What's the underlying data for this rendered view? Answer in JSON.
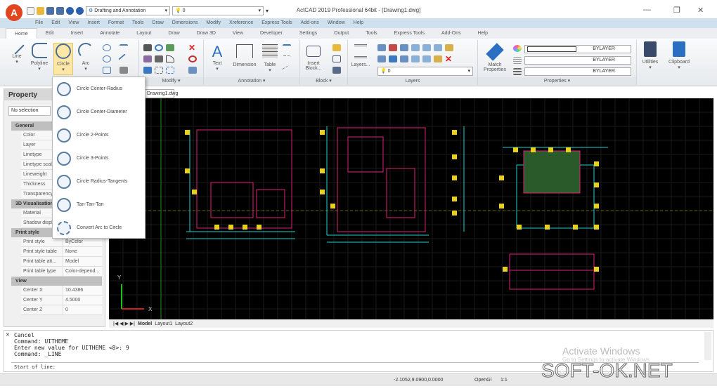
{
  "app": {
    "title": "ActCAD 2019 Professional 64bit - [Drawing1.dwg]",
    "logo_letter": "A"
  },
  "qat": {
    "workspace": "Drafting and Annotation",
    "layer": "0"
  },
  "menubar": [
    "File",
    "Edit",
    "View",
    "Insert",
    "Format",
    "Tools",
    "Draw",
    "Dimensions",
    "Modify",
    "Xreference",
    "Express Tools",
    "Add-ons",
    "Window",
    "Help"
  ],
  "tabs": [
    "Home",
    "Edit",
    "Insert",
    "Annotate",
    "Layout",
    "Draw",
    "Draw 3D",
    "View",
    "Developer",
    "Settings",
    "Output",
    "Tools",
    "Express Tools",
    "Add-Ons",
    "Help"
  ],
  "ribbon": {
    "draw": {
      "line": "Line",
      "polyline": "Polyline",
      "circle": "Circle",
      "arc": "Arc"
    },
    "modify_label": "Modify ▾",
    "annotation": {
      "text": "Text",
      "dimension": "Dimension",
      "table": "Table",
      "label": "Annotation ▾"
    },
    "block": {
      "insert": "Insert Block...",
      "label": "Block ▾"
    },
    "layers": {
      "button": "Layers...",
      "layer_value": "0",
      "label": "Layers"
    },
    "properties": {
      "match": "Match Properties",
      "color": "BYLAYER",
      "linetype": "BYLAYER",
      "lineweight": "BYLAYER",
      "label": "Properties ▾"
    },
    "utilities": "Utilities",
    "clipboard": "Clipboard"
  },
  "circle_menu": [
    "Circle Center-Radius",
    "Circle Center-Diameter",
    "Circle 2-Points",
    "Circle 3-Points",
    "Circle Radius-Tangents",
    "Tan-Tan-Tan",
    "Convert Arc to Circle"
  ],
  "property": {
    "title": "Property",
    "selection": "No selection",
    "sections": [
      {
        "name": "General",
        "rows": [
          [
            "Color",
            ""
          ],
          [
            "Layer",
            ""
          ],
          [
            "Linetype",
            ""
          ],
          [
            "Linetype scale",
            ""
          ],
          [
            "Lineweight",
            ""
          ],
          [
            "Thickness",
            ""
          ],
          [
            "Transparency",
            ""
          ]
        ]
      },
      {
        "name": "3D Visualisation",
        "rows": [
          [
            "Material",
            ""
          ],
          [
            "Shadow display",
            ""
          ]
        ]
      },
      {
        "name": "Print style",
        "rows": [
          [
            "Print style",
            "ByColor"
          ],
          [
            "Print style table",
            "None"
          ],
          [
            "Print table att...",
            "Model"
          ],
          [
            "Print table type",
            "Color-depend..."
          ]
        ]
      },
      {
        "name": "View",
        "rows": [
          [
            "Center X",
            "10.4386"
          ],
          [
            "Center Y",
            "4.5000"
          ],
          [
            "Center Z",
            "0"
          ]
        ]
      }
    ]
  },
  "doc_tab": "Drawing1.dwg",
  "layout_tabs": [
    "Model",
    "Layout1",
    "Layout2"
  ],
  "axes": {
    "x": "X",
    "y": "Y"
  },
  "command": {
    "history": [
      "Cancel",
      "Command: UITHEME",
      "Enter new value for UITHEME <8>: 9",
      "Command: _LINE"
    ],
    "prompt": "Start of line:"
  },
  "status": {
    "coords": "-2.1052,9.0900,0.0000",
    "renderer": "OpenGl",
    "scale": "1:1"
  },
  "watermark": {
    "activate": "Activate Windows",
    "settings": "Go to Settings to activate Windows",
    "site": "SOFT-OK.NET"
  }
}
